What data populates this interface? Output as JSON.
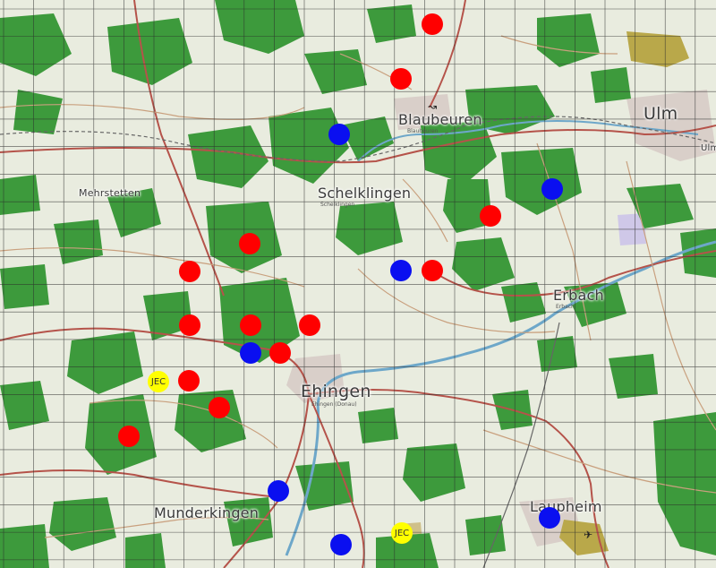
{
  "map": {
    "colors": {
      "background": "#e9ecdf",
      "forest": "#3d9a3c",
      "grid": "#2b2b2b",
      "road_major": "#b5534a",
      "road_minor": "#c9a07e",
      "river": "#6da7c9",
      "red_marker": "#ff0000",
      "blue_marker": "#0a0ff0",
      "yellow_marker": "#ffff00"
    },
    "towns": {
      "blaubeuren": "Blaubeuren",
      "blaubeuren_sub": "Blaubeuren",
      "ulm": "Ulm",
      "ulm_edge": "Ulm",
      "schelklingen": "Schelklingen",
      "schelklingen_sub": "Schelklingen",
      "mehrstetten": "Mehrstetten",
      "erbach": "Erbach",
      "erbach_sub": "Erbach",
      "ehingen": "Ehingen",
      "ehingen_sub": "Ehingen (Donau)",
      "munderkingen": "Munderkingen",
      "laupheim": "Laupheim"
    },
    "markers": {
      "yellow_label": "JEC"
    },
    "icons": {
      "airfield": "airfield-icon",
      "rail": "rail-icon"
    }
  }
}
